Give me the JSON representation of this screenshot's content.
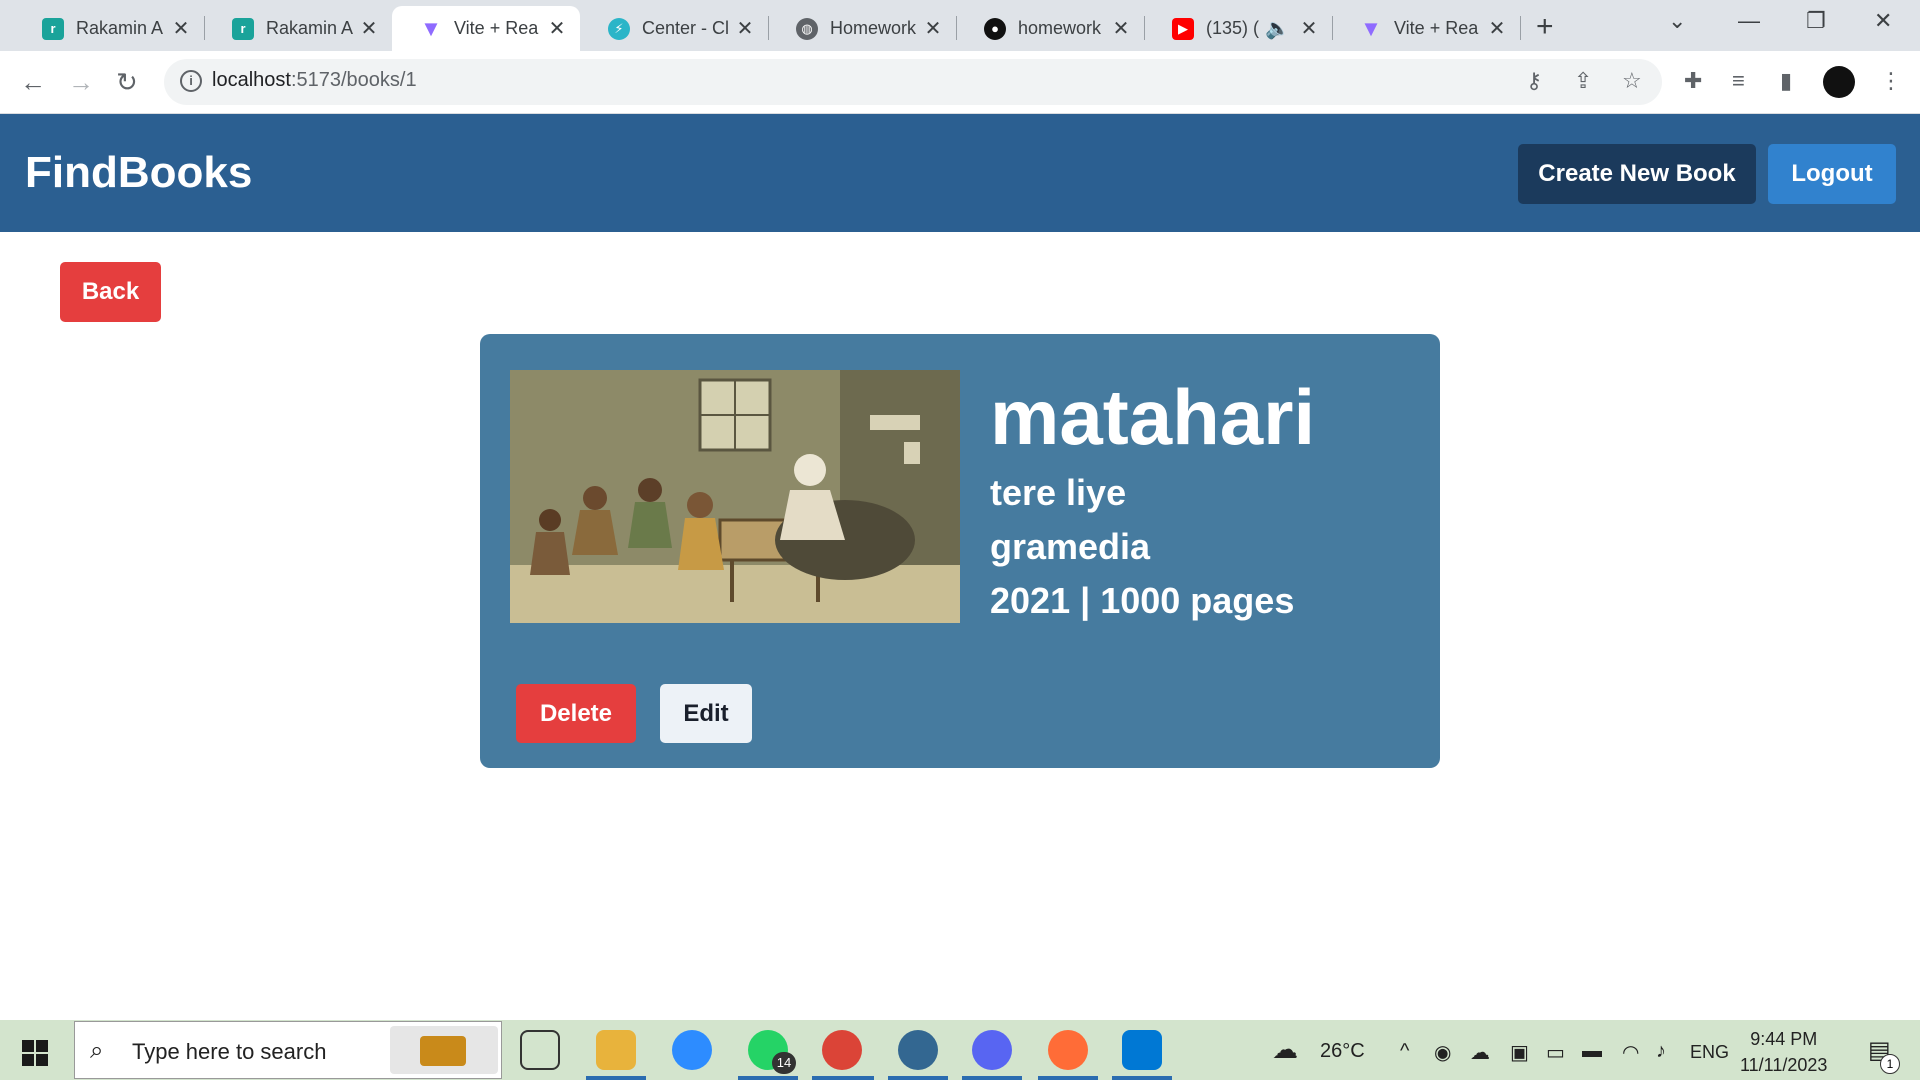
{
  "browser": {
    "tabs": [
      {
        "title": "Rakamin A",
        "favicon_color": "#1aa39a",
        "active": false
      },
      {
        "title": "Rakamin A",
        "favicon_color": "#1aa39a",
        "active": false
      },
      {
        "title": "Vite + Rea",
        "favicon_color": "#8f6bff",
        "active": true
      },
      {
        "title": "Center - Cl",
        "favicon_color": "#2bb5c8",
        "active": false
      },
      {
        "title": "Homework",
        "favicon_color": "#5f6368",
        "active": false
      },
      {
        "title": "homework",
        "favicon_color": "#111111",
        "active": false
      },
      {
        "title": "(135) (",
        "favicon_color": "#ff0000",
        "active": false
      },
      {
        "title": "Vite + Rea",
        "favicon_color": "#8f6bff",
        "active": false
      }
    ],
    "url_host": "localhost",
    "url_path": ":5173/books/1"
  },
  "app": {
    "brand": "FindBooks",
    "create_label": "Create New Book",
    "logout_label": "Logout",
    "back_label": "Back"
  },
  "book": {
    "title": "matahari",
    "author": "tere liye",
    "publisher": "gramedia",
    "year": "2021",
    "separator": "|",
    "pages": "1000 pages",
    "delete_label": "Delete",
    "edit_label": "Edit"
  },
  "taskbar": {
    "search_placeholder": "Type here to search",
    "whatsapp_badge": "14",
    "weather": "26°C",
    "language": "ENG",
    "time": "9:44 PM",
    "date": "11/11/2023",
    "notification_count": "1"
  },
  "colors": {
    "header": "#2b5f91",
    "card": "#467b9f",
    "danger": "#e53e3e",
    "primary": "#3182ce",
    "dark": "#1b3a5c"
  }
}
